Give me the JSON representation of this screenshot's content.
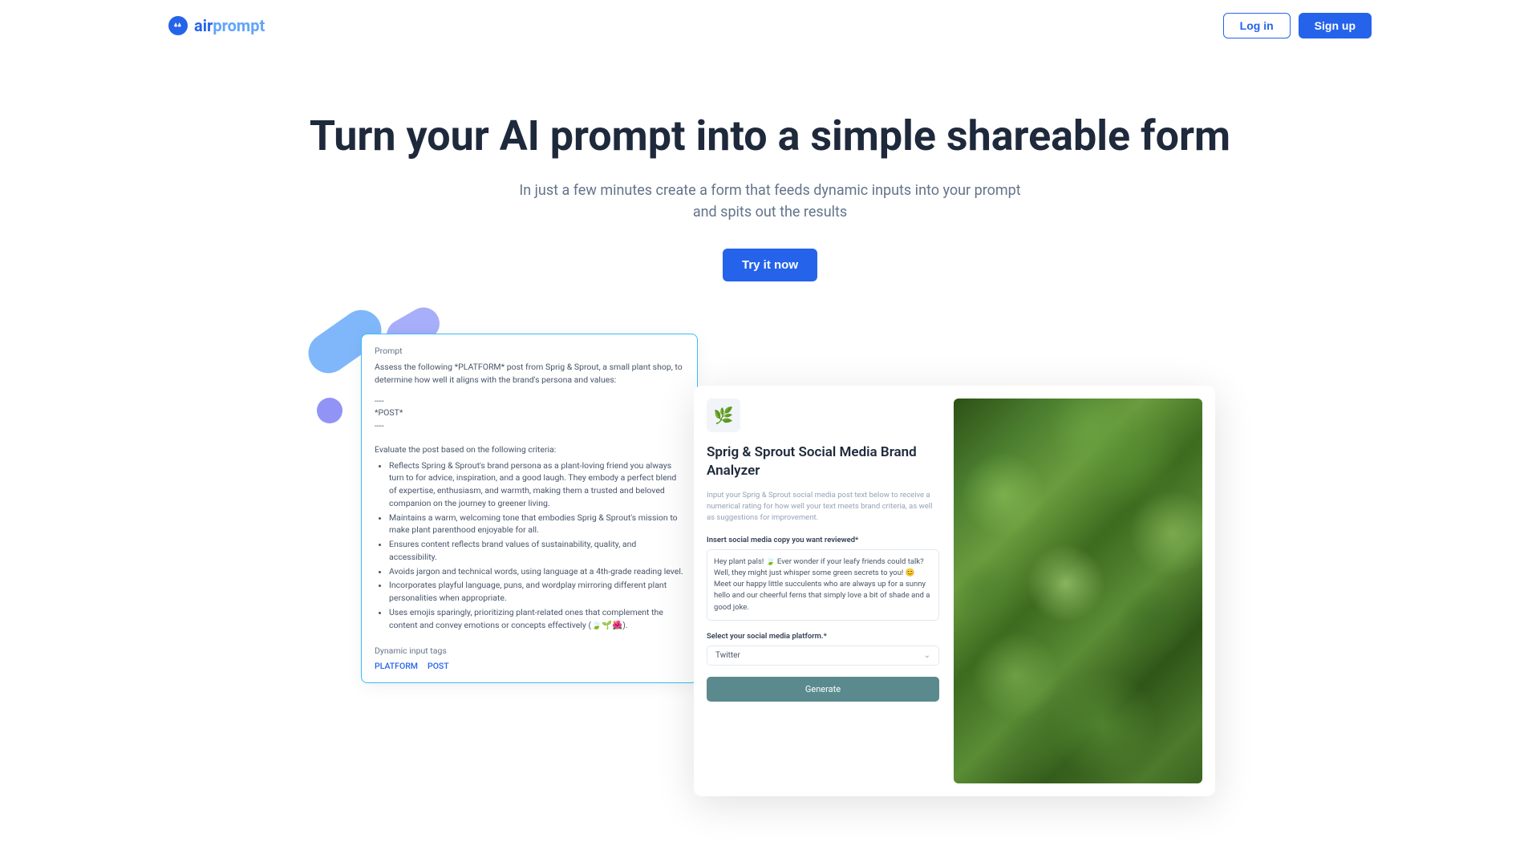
{
  "brand": {
    "name_part1": "air",
    "name_part2": "prompt"
  },
  "nav": {
    "login": "Log in",
    "signup": "Sign up"
  },
  "hero": {
    "title": "Turn your AI prompt into a simple shareable form",
    "subtitle": "In just a few minutes create a form that feeds dynamic inputs into your prompt and spits out the results",
    "cta": "Try it now"
  },
  "prompt_card": {
    "label": "Prompt",
    "intro": "Assess the following *PLATFORM* post from Sprig & Sprout, a small plant shop, to determine how well it aligns with the brand's persona and values:",
    "divider1": "----",
    "post_placeholder": "*POST*",
    "divider2": "----",
    "eval_label": "Evaluate the post based on the following criteria:",
    "criteria": [
      "Reflects Spring & Sprout's brand persona as a plant-loving friend you always turn to for advice, inspiration, and a good laugh. They embody a perfect blend of expertise, enthusiasm, and warmth, making them a trusted and beloved companion on the journey to greener living.",
      "Maintains a warm, welcoming tone that embodies Sprig & Sprout's mission to make plant parenthood enjoyable for all.",
      "Ensures content reflects brand values of sustainability, quality, and accessibility.",
      "Avoids jargon and technical words, using language at a 4th-grade reading level.",
      "Incorporates playful language, puns, and wordplay mirroring different plant personalities when appropriate.",
      "Uses emojis sparingly, prioritizing plant-related ones that complement the content and convey emotions or concepts effectively (🍃🌱🌺)."
    ],
    "tags_label": "Dynamic input tags",
    "tag1": "PLATFORM",
    "tag2": "POST"
  },
  "form_card": {
    "logo_emoji": "🌿",
    "title": "Sprig & Sprout Social Media Brand Analyzer",
    "description": "Input your Sprig & Sprout social media post text below to receive a numerical rating for how well your text meets brand criteria, as well as suggestions for improvement.",
    "field1_label": "Insert social media copy you want reviewed*",
    "field1_value": "Hey plant pals! 🍃 Ever wonder if your leafy friends could talk? Well, they might just whisper some green secrets to you! 😊 Meet our happy little succulents who are always up for a sunny hello and our cheerful ferns that simply love a bit of shade and a good joke.",
    "field2_label": "Select your social media platform.*",
    "field2_value": "Twitter",
    "generate_button": "Generate"
  }
}
